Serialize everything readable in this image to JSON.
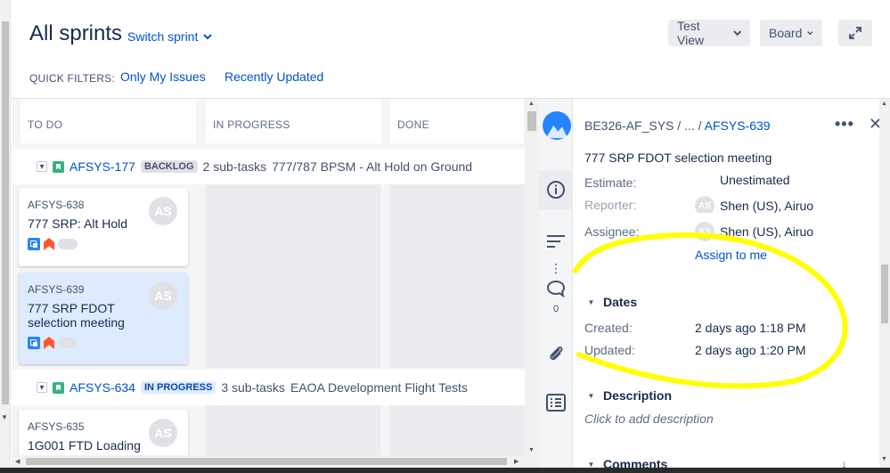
{
  "header": {
    "title": "All sprints",
    "switch_sprint": "Switch sprint",
    "view_button": "Test View",
    "board_button": "Board",
    "quick_filters_label": "QUICK FILTERS:",
    "quick_filters": [
      "Only My Issues",
      "Recently Updated"
    ]
  },
  "board": {
    "columns": [
      "TO DO",
      "IN PROGRESS",
      "DONE"
    ],
    "swimlanes": [
      {
        "key": "AFSYS-177",
        "status": "BACKLOG",
        "subtasks": "2 sub-tasks",
        "summary": "777/787 BPSM - Alt Hold on Ground",
        "cards": [
          {
            "key": "AFSYS-638",
            "summary": "777 SRP: Alt Hold",
            "avatar": "AS"
          },
          {
            "key": "AFSYS-639",
            "summary": "777 SRP FDOT selection meeting",
            "avatar": "AS"
          }
        ]
      },
      {
        "key": "AFSYS-634",
        "status": "IN PROGRESS",
        "subtasks": "3 sub-tasks",
        "summary": "EAOA Development Flight Tests",
        "cards": [
          {
            "key": "AFSYS-635",
            "summary": "1G001 FTD Loading",
            "avatar": "AS"
          }
        ]
      }
    ]
  },
  "sidebar": {
    "comment_count": "0"
  },
  "detail": {
    "project": "BE326-AF_SYS",
    "separator": "/",
    "ellipsis": "...",
    "issue_key": "AFSYS-639",
    "summary": "777 SRP FDOT selection meeting",
    "estimate_label": "Estimate:",
    "estimate_value": "Unestimated",
    "reporter_label": "Reporter:",
    "reporter_value": "Shen (US), Airuo",
    "assignee_label": "Assignee:",
    "assignee_value": "Shen (US), Airuo",
    "assign_to_me": "Assign to me",
    "dates_heading": "Dates",
    "created_label": "Created:",
    "created_value": "2 days ago 1:18 PM",
    "updated_label": "Updated:",
    "updated_value": "2 days ago 1:20 PM",
    "description_heading": "Description",
    "description_placeholder": "Click to add description",
    "comments_heading": "Comments",
    "user_initials": "AS"
  },
  "colors": {
    "link": "#0052cc",
    "annotation": "#ffff00",
    "selected_card": "#deebff"
  }
}
